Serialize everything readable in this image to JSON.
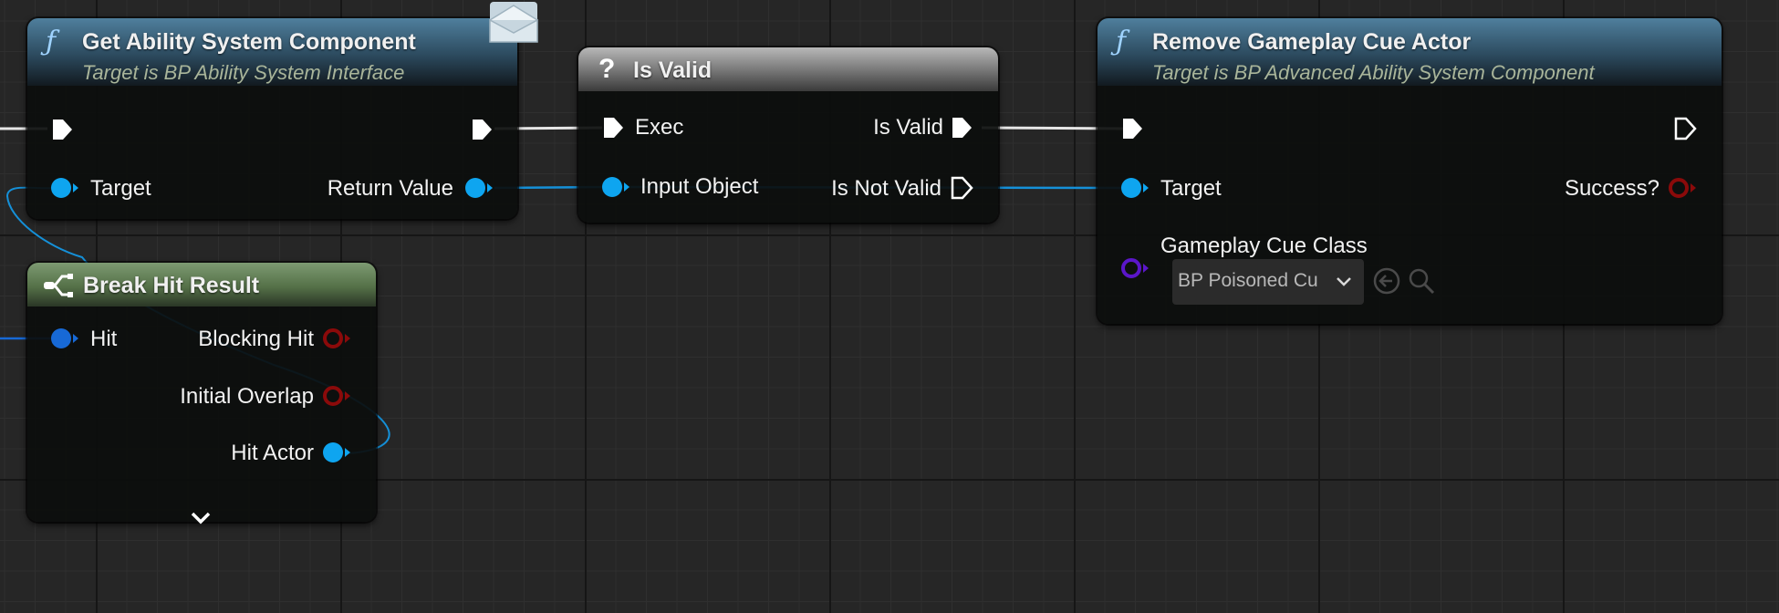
{
  "colors": {
    "exec": "#ffffff",
    "object_pin": "#0ea5f0",
    "struct_pin": "#1769d6",
    "bool_pin": "#8b0a0a",
    "class_pin": "#5b16c9",
    "object_wire": "#1590d8",
    "exec_wire": "#e8e8e8"
  },
  "nodes": {
    "get_asc": {
      "icon": "function-icon",
      "title": "Get Ability System Component",
      "subtitle": "Target is BP Ability System Interface",
      "pins": {
        "target": "Target",
        "return_value": "Return Value"
      }
    },
    "is_valid": {
      "icon": "question-icon",
      "title": "Is Valid",
      "pins": {
        "exec": "Exec",
        "input_object": "Input Object",
        "is_valid": "Is Valid",
        "is_not_valid": "Is Not Valid"
      }
    },
    "remove_cue": {
      "icon": "function-icon",
      "title": "Remove Gameplay Cue Actor",
      "subtitle": "Target is BP Advanced Ability System Component",
      "pins": {
        "target": "Target",
        "success": "Success?",
        "cue_class": "Gameplay Cue Class"
      },
      "dropdown_value": "BP Poisoned Cu"
    },
    "break_hit": {
      "icon": "break-struct-icon",
      "title": "Break Hit Result",
      "pins": {
        "hit": "Hit",
        "blocking_hit": "Blocking Hit",
        "initial_overlap": "Initial Overlap",
        "hit_actor": "Hit Actor"
      }
    }
  },
  "glyphs": {
    "function": "ƒ",
    "question": "?"
  }
}
